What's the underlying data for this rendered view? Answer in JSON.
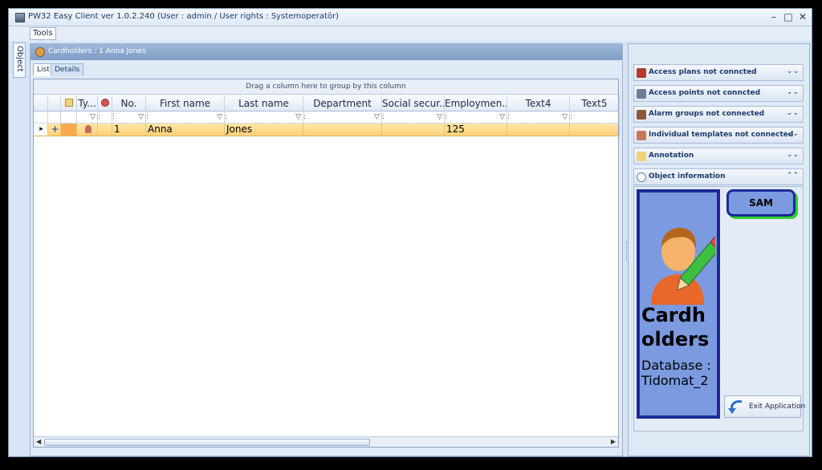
{
  "window": {
    "title": "PW32 Easy Client   ver 1.0.2.240   (User : admin / User rights : Systemoperatör)",
    "controls": {
      "minimize": "–",
      "maximize": "□",
      "close": "✕"
    }
  },
  "menu": {
    "tools": "Tools"
  },
  "sidebar": {
    "object_tab": "Object"
  },
  "panel": {
    "header": "Cardholders : 1 Anna Jones",
    "tabs": [
      {
        "label": "List"
      },
      {
        "label": "Details"
      }
    ]
  },
  "grid": {
    "group_hint": "Drag a column here to group by this column",
    "columns": [
      "",
      "",
      "Ty...",
      "",
      "No.",
      "First name",
      "Last name",
      "Department",
      "Social secur...",
      "Employmen...",
      "Text4",
      "Text5"
    ],
    "rows": [
      {
        "marker": "▸",
        "expand": "+",
        "no": "1",
        "first_name": "Anna",
        "last_name": "Jones",
        "department": "",
        "social": "",
        "employment": "125",
        "text4": "",
        "text5": ""
      }
    ]
  },
  "accordion": [
    {
      "label": "Access plans not conncted",
      "icon": "access-plan-icon",
      "chevron": "⌄⌄"
    },
    {
      "label": "Access points not conncted",
      "icon": "access-point-icon",
      "chevron": "⌄⌄"
    },
    {
      "label": "Alarm groups not connected",
      "icon": "alarm-icon",
      "chevron": "⌄⌄"
    },
    {
      "label": "Individual templates not connected",
      "icon": "template-icon",
      "chevron": "⌄⌄"
    },
    {
      "label": "Annotation",
      "icon": "annotation-icon",
      "chevron": "⌄⌄"
    },
    {
      "label": "Object information",
      "icon": "info-icon",
      "chevron": "⌃⌃"
    }
  ],
  "object_info": {
    "title": "Cardholders",
    "db_label": "Database :",
    "db_name": "Tidomat_2",
    "sam_label": "SAM",
    "exit_label": "Exit Application"
  },
  "colors": {
    "accent": "#1a2b96",
    "card_fill": "#7c9ae0",
    "selected_row": "#fdd27a",
    "sam_glow": "#2fd12f"
  }
}
